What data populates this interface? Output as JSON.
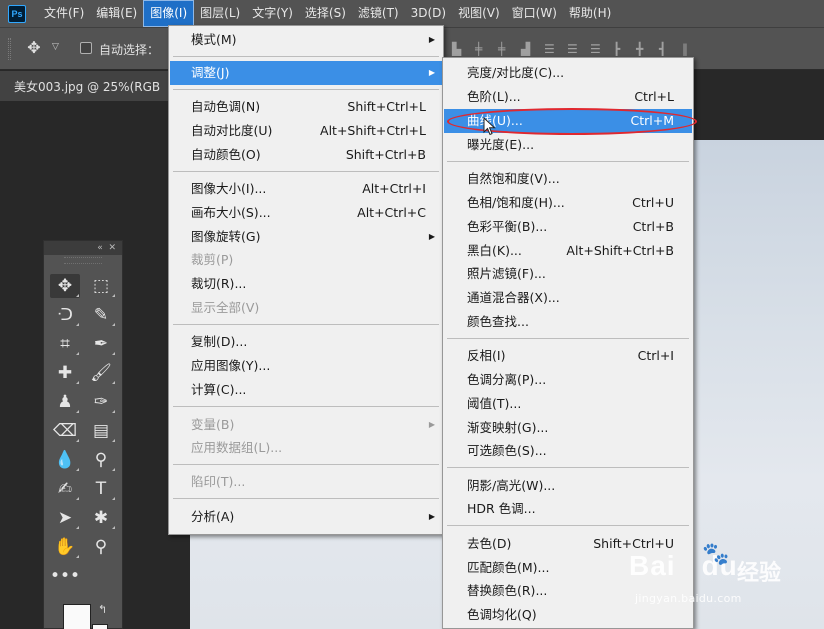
{
  "menubar": {
    "logo": "Ps",
    "items": [
      "文件(F)",
      "编辑(E)",
      "图像(I)",
      "图层(L)",
      "文字(Y)",
      "选择(S)",
      "滤镜(T)",
      "3D(D)",
      "视图(V)",
      "窗口(W)",
      "帮助(H)"
    ]
  },
  "options": {
    "autoselect": "自动选择："
  },
  "document": {
    "tab": "美女003.jpg @ 25%(RGB"
  },
  "image_menu": {
    "mode": "模式(M)",
    "adjust": "调整(J)",
    "auto_tone": "自动色调(N)",
    "auto_tone_sc": "Shift+Ctrl+L",
    "auto_contrast": "自动对比度(U)",
    "auto_contrast_sc": "Alt+Shift+Ctrl+L",
    "auto_color": "自动颜色(O)",
    "auto_color_sc": "Shift+Ctrl+B",
    "image_size": "图像大小(I)...",
    "image_size_sc": "Alt+Ctrl+I",
    "canvas_size": "画布大小(S)...",
    "canvas_size_sc": "Alt+Ctrl+C",
    "rotation": "图像旋转(G)",
    "crop": "裁剪(P)",
    "trim": "裁切(R)...",
    "reveal_all": "显示全部(V)",
    "duplicate": "复制(D)...",
    "apply_image": "应用图像(Y)...",
    "calculations": "计算(C)...",
    "variables": "变量(B)",
    "apply_dataset": "应用数据组(L)...",
    "trap": "陷印(T)...",
    "analysis": "分析(A)"
  },
  "adjust_menu": {
    "brightness": "亮度/对比度(C)...",
    "levels": "色阶(L)...",
    "levels_sc": "Ctrl+L",
    "curves": "曲线(U)...",
    "curves_sc": "Ctrl+M",
    "exposure": "曝光度(E)...",
    "vibrance": "自然饱和度(V)...",
    "hue_sat": "色相/饱和度(H)...",
    "hue_sat_sc": "Ctrl+U",
    "color_balance": "色彩平衡(B)...",
    "color_balance_sc": "Ctrl+B",
    "bw": "黑白(K)...",
    "bw_sc": "Alt+Shift+Ctrl+B",
    "photo_filter": "照片滤镜(F)...",
    "channel_mixer": "通道混合器(X)...",
    "color_lookup": "颜色查找...",
    "invert": "反相(I)",
    "invert_sc": "Ctrl+I",
    "posterize": "色调分离(P)...",
    "threshold": "阈值(T)...",
    "gradient_map": "渐变映射(G)...",
    "selective_color": "可选颜色(S)...",
    "shadows": "阴影/高光(W)...",
    "hdr": "HDR 色调...",
    "desaturate": "去色(D)",
    "desaturate_sc": "Shift+Ctrl+U",
    "match_color": "匹配颜色(M)...",
    "replace_color": "替换颜色(R)...",
    "equalize": "色调均化(Q)"
  },
  "watermark": {
    "brand": "Bai",
    "brand_suffix": "du",
    "jingyan": "经验",
    "url": "jingyan.baidu.com"
  },
  "colors": {
    "highlight": "#3b8fe6",
    "annotation": "#e0282f",
    "menu_bg": "#f0f0f0",
    "chrome": "#535353"
  }
}
